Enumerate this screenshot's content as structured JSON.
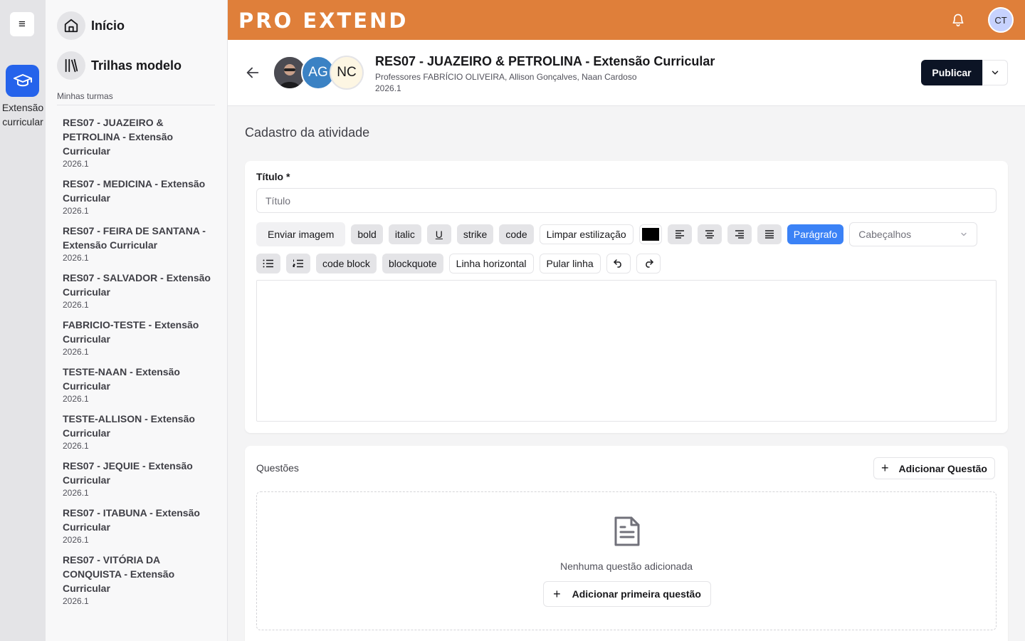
{
  "rail": {
    "menu_icon": "≡",
    "course_label": "Extensão curricular"
  },
  "sidebar": {
    "nav": [
      {
        "label": "Início",
        "icon": "home-icon"
      },
      {
        "label": "Trilhas modelo",
        "icon": "books-icon"
      }
    ],
    "section_label": "Minhas turmas",
    "classes": [
      {
        "name": "RES07 - JUAZEIRO & PETROLINA - Extensão Curricular",
        "year": "2026.1"
      },
      {
        "name": "RES07 - MEDICINA - Extensão Curricular",
        "year": "2026.1"
      },
      {
        "name": "RES07 - FEIRA DE SANTANA - Extensão Curricular",
        "year": "2026.1"
      },
      {
        "name": "RES07 - SALVADOR - Extensão Curricular",
        "year": "2026.1"
      },
      {
        "name": "FABRICIO-TESTE - Extensão Curricular",
        "year": "2026.1"
      },
      {
        "name": "TESTE-NAAN - Extensão Curricular",
        "year": "2026.1"
      },
      {
        "name": "TESTE-ALLISON - Extensão Curricular",
        "year": "2026.1"
      },
      {
        "name": "RES07 - JEQUIE - Extensão Curricular",
        "year": "2026.1"
      },
      {
        "name": "RES07 - ITABUNA - Extensão Curricular",
        "year": "2026.1"
      },
      {
        "name": "RES07 - VITÓRIA DA CONQUISTA - Extensão Curricular",
        "year": "2026.1"
      }
    ]
  },
  "topbar": {
    "logo": "PRO EXTEND",
    "user_initials": "CT",
    "accent_color": "#df7f3a"
  },
  "header": {
    "avatars": [
      "AG",
      "NC"
    ],
    "title": "RES07 - JUAZEIRO & PETROLINA - Extensão Curricular",
    "professors": "Professores FABRÍCIO OLIVEIRA, Allison Gonçalves, Naan Cardoso",
    "year": "2026.1",
    "publish_label": "Publicar"
  },
  "page": {
    "title": "Cadastro da atividade"
  },
  "form": {
    "title_label": "Título *",
    "title_placeholder": "Título",
    "toolbar": {
      "upload_image": "Enviar imagem",
      "bold": "bold",
      "italic": "italic",
      "underline": "U",
      "strike": "strike",
      "code": "code",
      "clear": "Limpar estilização",
      "text_color": "#000000",
      "paragraph": "Parágrafo",
      "headings_placeholder": "Cabeçalhos",
      "code_block": "code block",
      "blockquote": "blockquote",
      "horizontal_rule": "Linha horizontal",
      "line_break": "Pular linha"
    }
  },
  "questions": {
    "label": "Questões",
    "add_label": "Adicionar Questão",
    "empty_text": "Nenhuma questão adicionada",
    "add_first_label": "Adicionar primeira questão"
  }
}
